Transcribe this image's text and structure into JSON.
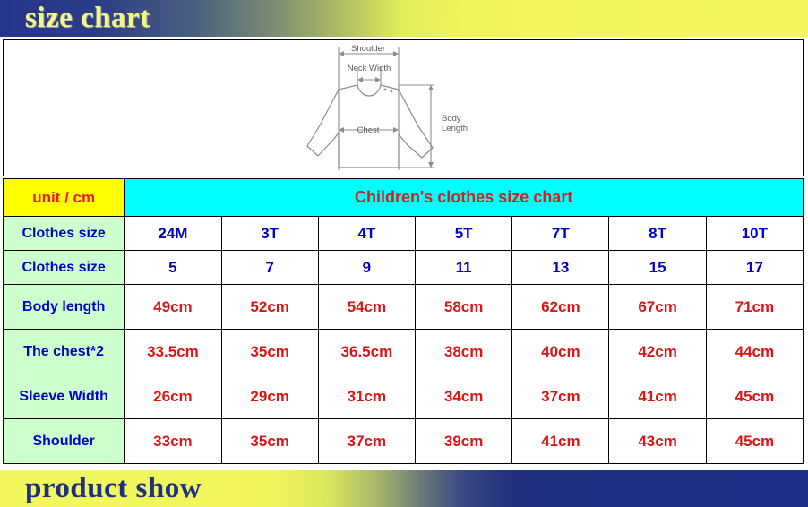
{
  "banners": {
    "top_title": "size chart",
    "bottom_title": "product show"
  },
  "diagram": {
    "name": "garment-measurement-diagram",
    "labels": {
      "shoulder": "Shoulder",
      "neck_width": "Neck Width",
      "chest": "Chest",
      "body_length_line1": "Body",
      "body_length_line2": "Length"
    }
  },
  "table": {
    "unit_label": "unit / cm",
    "title": "Children's clothes size chart",
    "columns": [
      "24M",
      "3T",
      "4T",
      "5T",
      "7T",
      "8T",
      "10T"
    ],
    "rows": [
      {
        "label": "Clothes size",
        "type": "size",
        "values": [
          "24M",
          "3T",
          "4T",
          "5T",
          "7T",
          "8T",
          "10T"
        ]
      },
      {
        "label": "Clothes size",
        "type": "size",
        "values": [
          "5",
          "7",
          "9",
          "11",
          "13",
          "15",
          "17"
        ]
      },
      {
        "label": "Body length",
        "type": "measure",
        "values": [
          "49cm",
          "52cm",
          "54cm",
          "58cm",
          "62cm",
          "67cm",
          "71cm"
        ]
      },
      {
        "label": "The chest*2",
        "type": "measure",
        "values": [
          "33.5cm",
          "35cm",
          "36.5cm",
          "38cm",
          "40cm",
          "42cm",
          "44cm"
        ]
      },
      {
        "label": "Sleeve Width",
        "type": "measure",
        "values": [
          "26cm",
          "29cm",
          "31cm",
          "34cm",
          "37cm",
          "41cm",
          "45cm"
        ]
      },
      {
        "label": "Shoulder",
        "type": "measure",
        "values": [
          "33cm",
          "35cm",
          "37cm",
          "39cm",
          "41cm",
          "43cm",
          "45cm"
        ]
      }
    ]
  },
  "colors": {
    "banner_blue": "#1f3087",
    "banner_yellow": "#f2f85c",
    "unit_cell_bg": "#ffff00",
    "title_cell_bg": "#00ffff",
    "row_label_bg": "#ccffcc",
    "size_text": "#0000cc",
    "measure_text": "#e01414",
    "title_text": "#cc2222",
    "unit_text": "#ef1c1c"
  }
}
